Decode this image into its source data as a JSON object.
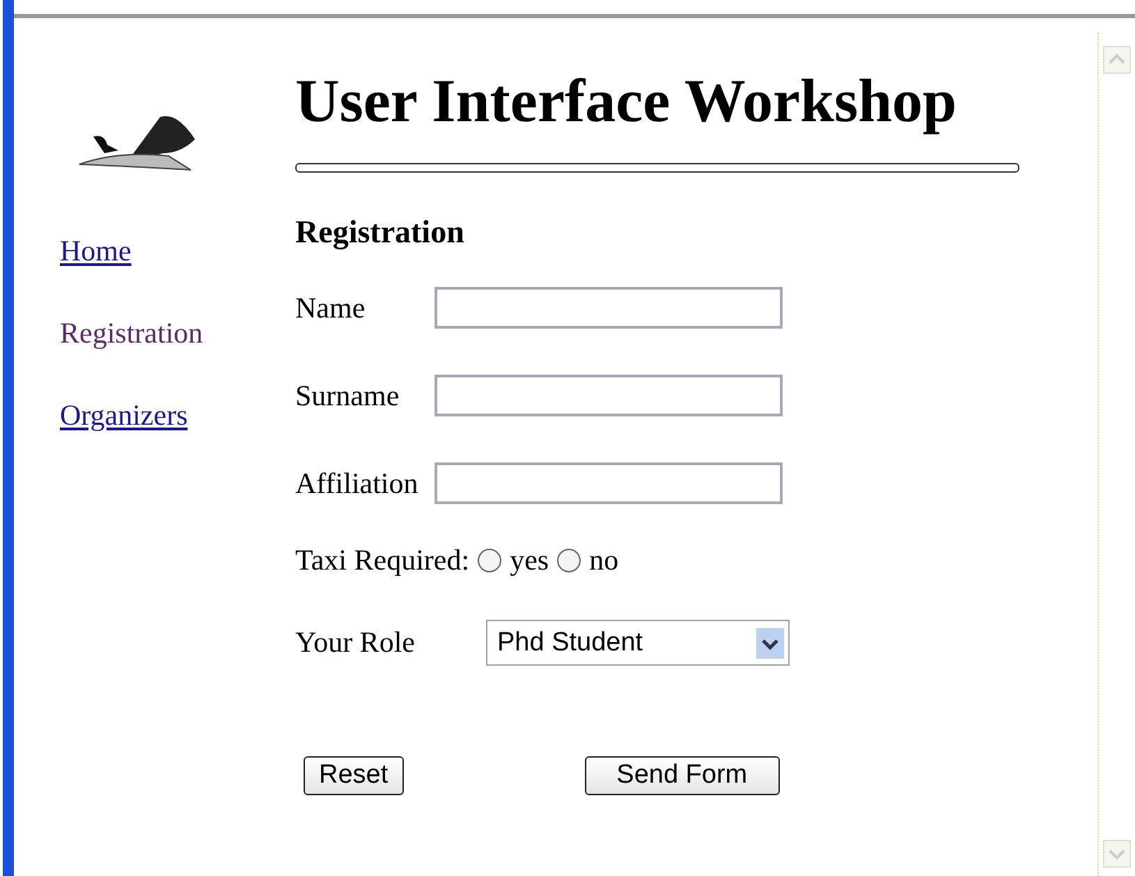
{
  "header": {
    "title": "User Interface Workshop"
  },
  "nav": [
    {
      "label": "Home",
      "selected": false
    },
    {
      "label": "Registration",
      "selected": true
    },
    {
      "label": "Organizers",
      "selected": false
    }
  ],
  "form": {
    "heading": "Registration",
    "fields": [
      {
        "label": "Name"
      },
      {
        "label": "Surname"
      },
      {
        "label": "Affiliation"
      }
    ],
    "taxi": {
      "label": "Taxi Required:",
      "options": [
        {
          "label": "yes",
          "checked": false
        },
        {
          "label": "no",
          "checked": false
        }
      ]
    },
    "role": {
      "label": "Your Role",
      "value": "Phd Student"
    },
    "buttons": [
      "Reset",
      "Send Form"
    ]
  }
}
